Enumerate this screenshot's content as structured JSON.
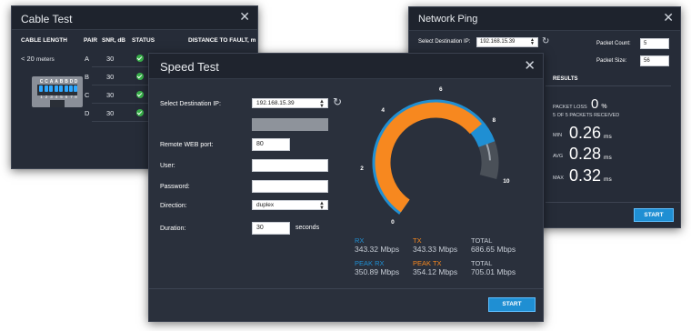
{
  "cable_test": {
    "title": "Cable Test",
    "close_icon": "close-icon",
    "headers": [
      "CABLE LENGTH",
      "PAIR",
      "SNR, dB",
      "STATUS",
      "DISTANCE TO FAULT, m"
    ],
    "length_value": "< 20",
    "length_unit": "meters",
    "pins_top": [
      "C",
      "C",
      "A",
      "A",
      "B",
      "B",
      "D",
      "D"
    ],
    "pins_num": [
      "1",
      "2",
      "3",
      "4",
      "5",
      "6",
      "7",
      "8"
    ],
    "rows": [
      {
        "pair": "A",
        "snr": "30",
        "status": "check-icon"
      },
      {
        "pair": "B",
        "snr": "30",
        "status": "check-icon"
      },
      {
        "pair": "C",
        "snr": "30",
        "status": "check-icon"
      },
      {
        "pair": "D",
        "snr": "30",
        "status": "check-icon"
      }
    ],
    "status_color": "#38b24a"
  },
  "network_ping": {
    "title": "Network Ping",
    "close_icon": "close-icon",
    "dest_label": "Select Destination IP:",
    "dest_value": "192.168.15.39",
    "refresh_icon": "refresh-icon",
    "packet_count_label": "Packet Count:",
    "packet_count_value": "5",
    "packet_size_label": "Packet Size:",
    "packet_size_value": "56",
    "results_label": "RESULTS",
    "packet_loss_label": "PACKET LOSS",
    "packet_loss_value": "0",
    "packet_loss_unit": "%",
    "packets_received": "5 OF 5 PACKETS RECEIVED",
    "min_label": "MIN",
    "min_value": "0.26",
    "avg_label": "AVG",
    "avg_value": "0.28",
    "max_label": "MAX",
    "max_value": "0.32",
    "ms_unit": "ms",
    "start_label": "START"
  },
  "speed_test": {
    "title": "Speed Test",
    "close_icon": "close-icon",
    "dest_label": "Select Destination IP:",
    "dest_value": "192.168.15.39",
    "refresh_icon": "refresh-icon",
    "port_label": "Remote WEB port:",
    "port_value": "80",
    "user_label": "User:",
    "user_value": "",
    "password_label": "Password:",
    "password_value": "",
    "direction_label": "Direction:",
    "direction_value": "duplex",
    "duration_label": "Duration:",
    "duration_value": "30",
    "duration_unit": "seconds",
    "gauge_ticks": [
      "0",
      "2",
      "4",
      "6",
      "8",
      "10"
    ],
    "gauge_max": 10,
    "rx_fraction": 0.34,
    "tx_fraction": 0.34,
    "rx_label": "RX",
    "rx_value": "343.32 Mbps",
    "tx_label": "TX",
    "tx_value": "343.33 Mbps",
    "total_label": "TOTAL",
    "total_value": "686.65 Mbps",
    "peak_rx_label": "PEAK RX",
    "peak_rx_value": "350.89 Mbps",
    "peak_tx_label": "PEAK TX",
    "peak_tx_value": "354.12 Mbps",
    "peak_total_label": "TOTAL",
    "peak_total_value": "705.01 Mbps",
    "start_label": "START",
    "colors": {
      "rx": "#1f8fd3",
      "tx": "#f7881f",
      "track": "#4a5058"
    }
  }
}
